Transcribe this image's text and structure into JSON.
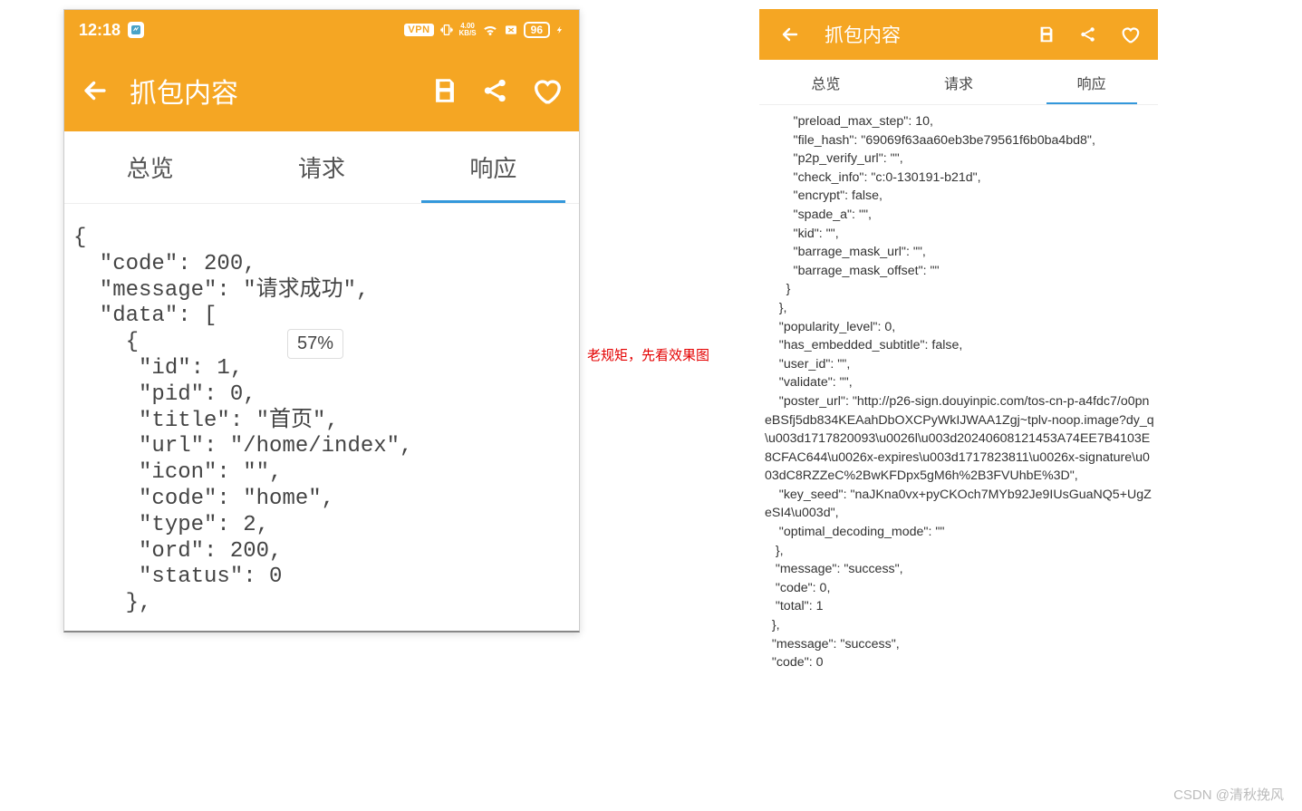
{
  "status_bar": {
    "time": "12:18",
    "net_speed_top": "4.00",
    "net_speed_bottom": "KB/S",
    "vpn": "VPN",
    "battery": "96"
  },
  "header": {
    "title": "抓包内容"
  },
  "tabs": {
    "overview": "总览",
    "request": "请求",
    "response": "响应"
  },
  "left_phone": {
    "percent_badge": "57%",
    "response_body": "{\n  \"code\": 200,\n  \"message\": \"请求成功\",\n  \"data\": [\n    {\n     \"id\": 1,\n     \"pid\": 0,\n     \"title\": \"首页\",\n     \"url\": \"/home/index\",\n     \"icon\": \"\",\n     \"code\": \"home\",\n     \"type\": 2,\n     \"ord\": 200,\n     \"status\": 0\n    },"
  },
  "right_phone": {
    "response_body": "        \"preload_max_step\": 10,\n        \"file_hash\": \"69069f63aa60eb3be79561f6b0ba4bd8\",\n        \"p2p_verify_url\": \"\",\n        \"check_info\": \"c:0-130191-b21d\",\n        \"encrypt\": false,\n        \"spade_a\": \"\",\n        \"kid\": \"\",\n        \"barrage_mask_url\": \"\",\n        \"barrage_mask_offset\": \"\"\n      }\n    },\n    \"popularity_level\": 0,\n    \"has_embedded_subtitle\": false,\n    \"user_id\": \"\",\n    \"validate\": \"\",\n    \"poster_url\": \"http://p26-sign.douyinpic.com/tos-cn-p-a4fdc7/o0pneBSfj5db834KEAahDbOXCPyWkIJWAA1Zgj~tplv-noop.image?dy_q\\u003d1717820093\\u0026l\\u003d20240608121453A74EE7B4103E8CFAC644\\u0026x-expires\\u003d1717823811\\u0026x-signature\\u003dC8RZZeC%2BwKFDpx5gM6h%2B3FVUhbE%3D\",\n    \"key_seed\": \"naJKna0vx+pyCKOch7MYb92Je9IUsGuaNQ5+UgZeSI4\\u003d\",\n    \"optimal_decoding_mode\": \"\"\n   },\n   \"message\": \"success\",\n   \"code\": 0,\n   \"total\": 1\n  },\n  \"message\": \"success\",\n  \"code\": 0"
  },
  "caption": "老规矩，先看效果图",
  "watermark": "CSDN @清秋挽风",
  "icons": {
    "back": "back-arrow",
    "save": "save-icon",
    "share": "share-icon",
    "heart": "heart-icon",
    "app": "app-icon",
    "vibrate": "vibrate-icon",
    "wifi": "wifi-icon",
    "close": "close-badge-icon",
    "bolt": "bolt-icon"
  }
}
